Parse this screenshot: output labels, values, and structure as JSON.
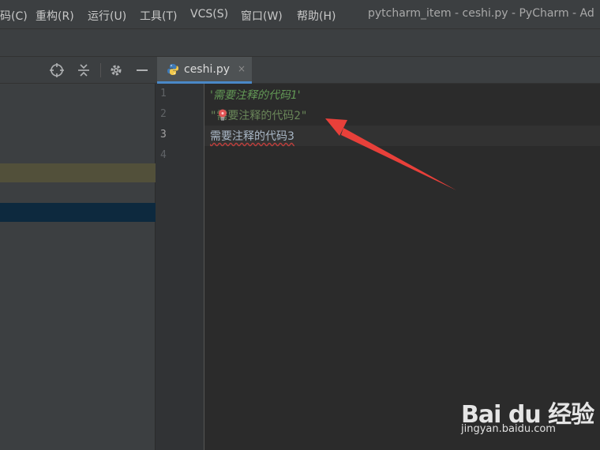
{
  "menubar": {
    "items": [
      "码(C)",
      "重构(R)",
      "运行(U)",
      "工具(T)",
      "VCS(S)",
      "窗口(W)",
      "帮助(H)"
    ],
    "window_title": "pytcharm_item - ceshi.py - PyCharm - Ad"
  },
  "project_panel": {
    "icons": [
      "crosshair-icon",
      "collapse-icon",
      "gear-icon",
      "minimize-icon"
    ]
  },
  "editor": {
    "tab": {
      "label": "ceshi.py",
      "icon": "python-file-icon",
      "close": "×"
    },
    "line_numbers": [
      "1",
      "2",
      "3",
      "4"
    ],
    "current_line": 3,
    "lines": [
      "'需要注释的代码1'",
      "\"需要注释的代码2\"",
      "需要注释的代码3",
      ""
    ]
  },
  "annotation": {
    "color": "#e8403a"
  },
  "watermark": {
    "main": "Bai du 经验",
    "sub": "jingyan.baidu.com"
  }
}
